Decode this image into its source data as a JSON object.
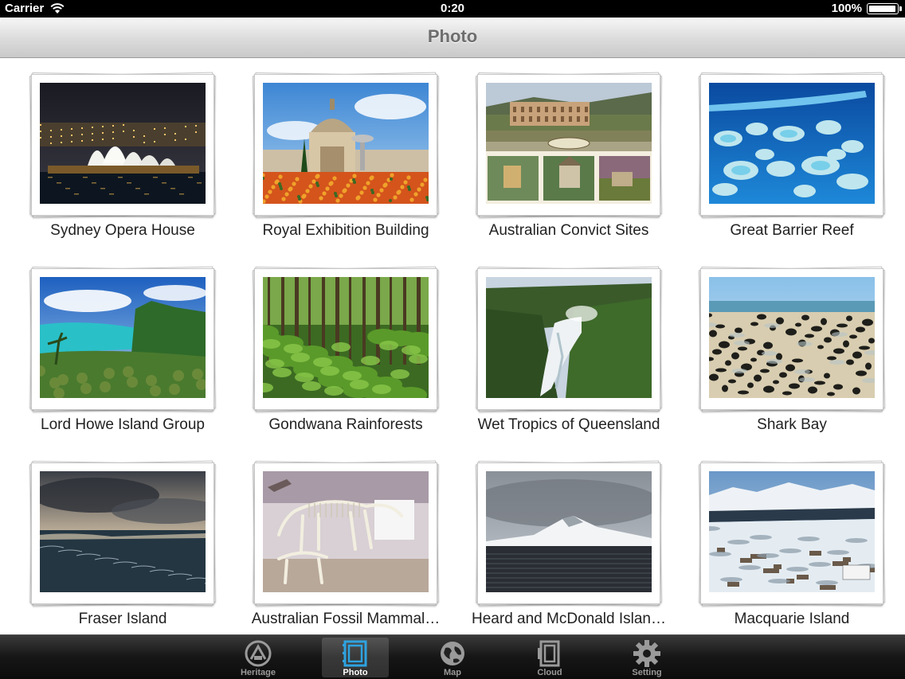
{
  "status_bar": {
    "carrier": "Carrier",
    "time": "0:20",
    "battery": "100%",
    "battery_level": 1.0
  },
  "nav": {
    "title": "Photo"
  },
  "photos": [
    {
      "caption": "Sydney Opera House",
      "scene": "opera"
    },
    {
      "caption": "Royal Exhibition Building",
      "scene": "exhibition"
    },
    {
      "caption": "Australian Convict Sites",
      "scene": "convict"
    },
    {
      "caption": "Great Barrier Reef",
      "scene": "reef"
    },
    {
      "caption": "Lord Howe Island Group",
      "scene": "lordhowe"
    },
    {
      "caption": "Gondwana Rainforests",
      "scene": "rainforest"
    },
    {
      "caption": "Wet Tropics of Queensland",
      "scene": "waterfall"
    },
    {
      "caption": "Shark Bay",
      "scene": "sharkbay"
    },
    {
      "caption": "Fraser Island",
      "scene": "fraser"
    },
    {
      "caption": "Australian Fossil Mammal…",
      "scene": "fossil"
    },
    {
      "caption": "Heard and McDonald Islan…",
      "scene": "heard"
    },
    {
      "caption": "Macquarie Island",
      "scene": "macquarie"
    }
  ],
  "tabs": [
    {
      "label": "Heritage",
      "icon": "heritage-icon",
      "active": false
    },
    {
      "label": "Photo",
      "icon": "photo-icon",
      "active": true
    },
    {
      "label": "Map",
      "icon": "globe-icon",
      "active": false
    },
    {
      "label": "Cloud",
      "icon": "cloud-icon",
      "active": false
    },
    {
      "label": "Setting",
      "icon": "gear-icon",
      "active": false
    }
  ],
  "colors": {
    "tab_active": "#ffffff",
    "tab_inactive": "#9a9a9a",
    "photo_accent": "#2ea3e0"
  }
}
